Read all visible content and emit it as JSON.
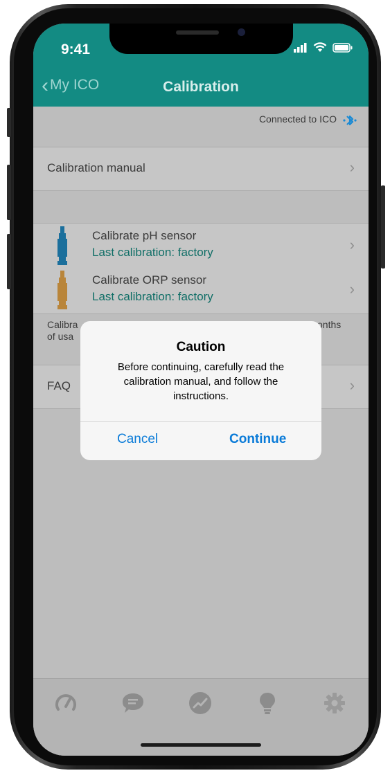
{
  "status": {
    "time": "9:41"
  },
  "nav": {
    "back_label": "My ICO",
    "title": "Calibration"
  },
  "connection": {
    "text": "Connected to ICO"
  },
  "manual_row": {
    "label": "Calibration manual"
  },
  "sensors": [
    {
      "title": "Calibrate pH sensor",
      "subtitle": "Last calibration: factory",
      "color": "#1b6f9c"
    },
    {
      "title": "Calibrate ORP sensor",
      "subtitle": "Last calibration: factory",
      "color": "#b9853a"
    }
  ],
  "note": {
    "left_line1": "Calibra",
    "right_line1": "onths",
    "left_line2": "of usa"
  },
  "faq_row": {
    "label": "FAQ"
  },
  "alert": {
    "title": "Caution",
    "message": "Before continuing, carefully read the calibration manual, and follow the instructions.",
    "cancel_label": "Cancel",
    "continue_label": "Continue"
  },
  "tabs": [
    "gauge-icon",
    "chat-icon",
    "trend-icon",
    "lightbulb-icon",
    "gear-icon"
  ],
  "colors": {
    "header": "#138b83",
    "accent_blue": "#0a7bd8",
    "bluetooth": "#1a8ad4"
  }
}
